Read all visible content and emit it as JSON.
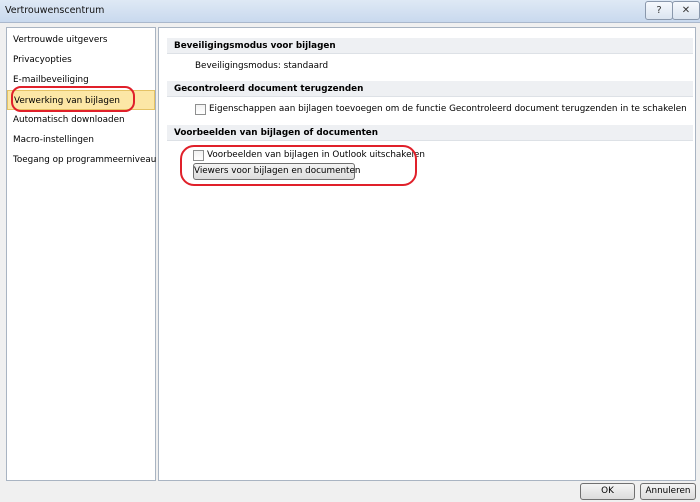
{
  "window": {
    "title": "Vertrouwenscentrum",
    "help_label": "?",
    "close_label": "✕"
  },
  "sidebar": {
    "items": [
      {
        "label": "Vertrouwde uitgevers"
      },
      {
        "label": "Privacyopties"
      },
      {
        "label": "E-mailbeveiliging"
      },
      {
        "label": "Verwerking van bijlagen",
        "selected": true
      },
      {
        "label": "Automatisch downloaden"
      },
      {
        "label": "Macro-instellingen"
      },
      {
        "label": "Toegang op programmeerniveau"
      }
    ]
  },
  "sections": {
    "security_mode": {
      "heading": "Beveiligingsmodus voor bijlagen",
      "value_text": "Beveiligingsmodus: standaard"
    },
    "controlled_document": {
      "heading": "Gecontroleerd document terugzenden",
      "checkbox_label": "Eigenschappen aan bijlagen toevoegen om de functie Gecontroleerd document terugzenden in te schakelen",
      "checked": false
    },
    "previews": {
      "heading": "Voorbeelden van bijlagen of documenten",
      "checkbox_label": "Voorbeelden van bijlagen in Outlook uitschakelen",
      "checked": false,
      "viewers_button_label": "Viewers voor bijlagen en documenten"
    }
  },
  "footer": {
    "ok_label": "OK",
    "cancel_label": "Annuleren"
  },
  "colors": {
    "selected_item": "#fce7a6",
    "annotation_red": "#e0202a",
    "section_header": "#eef0f3"
  }
}
